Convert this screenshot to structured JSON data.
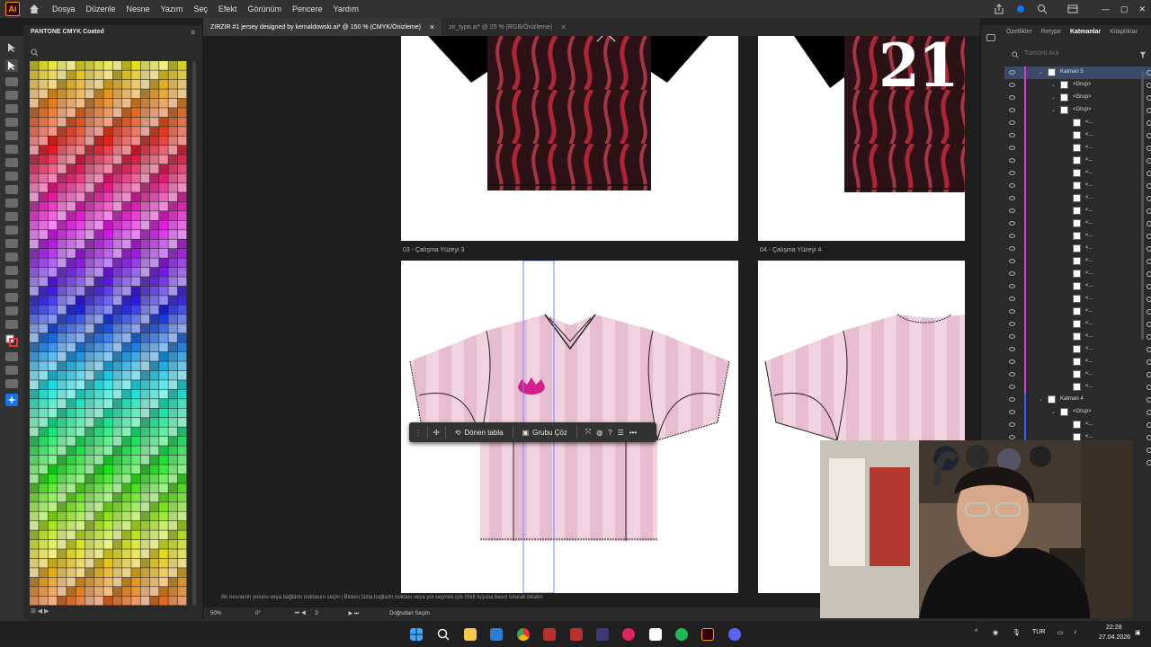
{
  "app": {
    "logo": "Ai"
  },
  "menu": [
    "Dosya",
    "Düzenle",
    "Nesne",
    "Yazım",
    "Seç",
    "Efekt",
    "Görünüm",
    "Pencere",
    "Yardım"
  ],
  "tabs": [
    {
      "label": "ZIRZIR #1 jersey designed by kemaldowski.ai* @ 150 % (CMYK/Önizleme)",
      "close": "×"
    },
    {
      "label": "zir_typo.ai* @ 25 % (RGB/Önizleme)",
      "close": "×"
    }
  ],
  "swatches": {
    "title": "PANTONE CMYK Coated"
  },
  "artboards": {
    "label3": "03 - Çalışma Yüzeyi 3",
    "label4": "04 - Çalışma Yüzeyi 4",
    "jersey_number": "21"
  },
  "context_bar": {
    "rotate_label": "Dönen tabla",
    "ungroup_label": "Grubu Çöz"
  },
  "right_panel": {
    "tabs": [
      "Özellikler",
      "Retype",
      "Katmanlar",
      "Kitaplıklar"
    ],
    "search_placeholder": "Tümünü Ara",
    "layers": [
      {
        "label": "Katman 5",
        "indent": 0
      },
      {
        "label": "<Grup>",
        "indent": 1
      },
      {
        "label": "<Grup>",
        "indent": 1
      },
      {
        "label": "<Grup>",
        "indent": 1
      },
      {
        "label": "<...",
        "indent": 2
      },
      {
        "label": "<...",
        "indent": 2
      },
      {
        "label": "<...",
        "indent": 2
      },
      {
        "label": "<...",
        "indent": 2
      },
      {
        "label": "<...",
        "indent": 2
      },
      {
        "label": "<...",
        "indent": 2
      },
      {
        "label": "<...",
        "indent": 2
      },
      {
        "label": "<...",
        "indent": 2
      },
      {
        "label": "<...",
        "indent": 2
      },
      {
        "label": "<...",
        "indent": 2
      },
      {
        "label": "<...",
        "indent": 2
      },
      {
        "label": "<...",
        "indent": 2
      },
      {
        "label": "<...",
        "indent": 2
      },
      {
        "label": "<...",
        "indent": 2
      },
      {
        "label": "<...",
        "indent": 2
      },
      {
        "label": "<...",
        "indent": 2
      },
      {
        "label": "<...",
        "indent": 2
      },
      {
        "label": "<...",
        "indent": 2
      },
      {
        "label": "<...",
        "indent": 2
      },
      {
        "label": "<...",
        "indent": 2
      },
      {
        "label": "<...",
        "indent": 2
      },
      {
        "label": "<...",
        "indent": 2
      },
      {
        "label": "Katman 4",
        "indent": 0
      },
      {
        "label": "<Grup>",
        "indent": 1
      },
      {
        "label": "<...",
        "indent": 2
      },
      {
        "label": "<...",
        "indent": 2
      },
      {
        "label": "<...",
        "indent": 2
      },
      {
        "label": "<...",
        "indent": 2
      }
    ]
  },
  "status": {
    "hint": "Bir nesnenin yolunu veya bağlantı noktasını seçin  |  Birden fazla bağlantı noktası veya yol seçmek için Shift tuşuna basılı tutarak tıklatın",
    "zoom": "50%",
    "rotation": "0°",
    "artboard_num": "3",
    "tool": "Doğrudan Seçim"
  },
  "taskbar": {
    "lang": "TUR",
    "time": "22:28",
    "date": "27.04.2026"
  },
  "colors": {
    "accent": "#1473e6",
    "ai_orange": "#ff9a00",
    "jersey_pink": "#e8bcd0",
    "flame_red": "#c8283c"
  }
}
